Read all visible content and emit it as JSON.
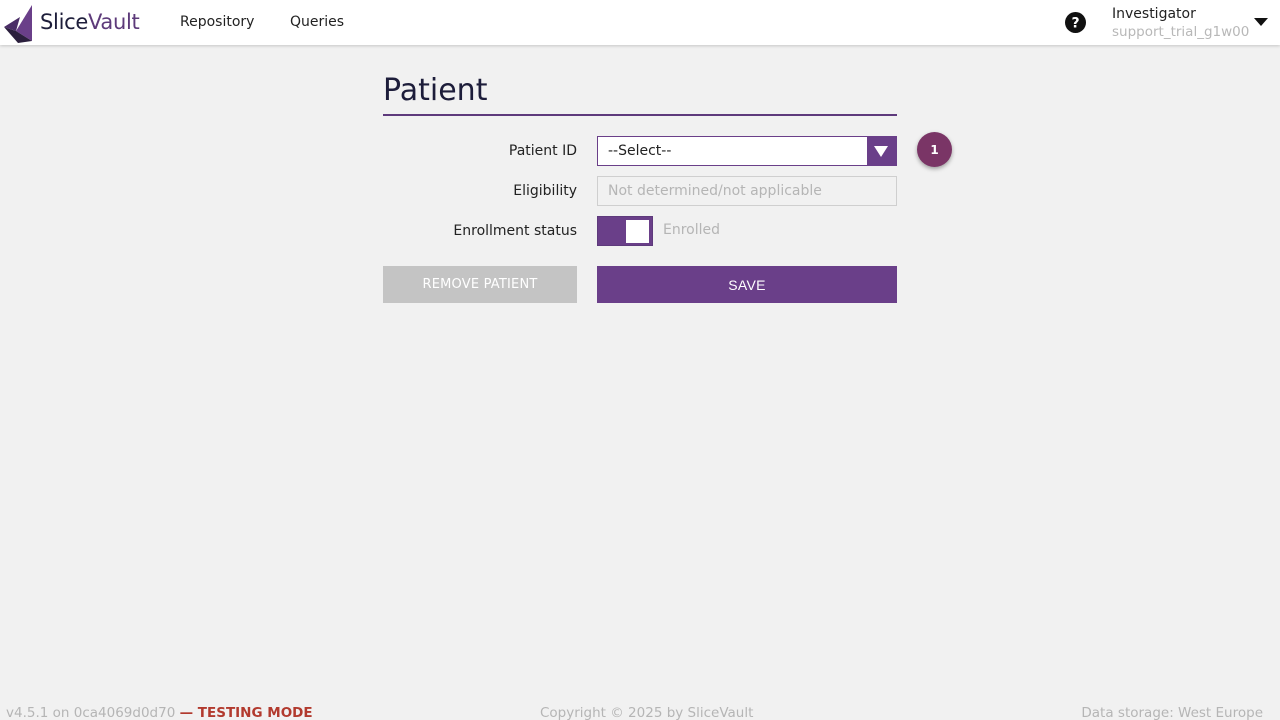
{
  "header": {
    "brand_part1": "Slice",
    "brand_part2": "Vault",
    "nav": [
      {
        "label": "Repository"
      },
      {
        "label": "Queries"
      }
    ],
    "help_icon": "question-circle-icon",
    "user": {
      "role": "Investigator",
      "username": "support_trial_g1w00"
    }
  },
  "main": {
    "title": "Patient",
    "fields": {
      "patient_id": {
        "label": "Patient ID",
        "value": "--Select--"
      },
      "eligibility": {
        "label": "Eligibility",
        "placeholder": "Not determined/not applicable"
      },
      "enrollment": {
        "label": "Enrollment status",
        "state_label": "Enrolled",
        "on": true
      }
    },
    "step_badge": "1",
    "buttons": {
      "remove": "REMOVE PATIENT",
      "save": "SAVE"
    }
  },
  "footer": {
    "version": "v4.5.1 on 0ca4069d0d70",
    "mode": "— TESTING MODE",
    "copyright": "Copyright © 2025 by SliceVault",
    "storage": "Data storage: West Europe"
  },
  "colors": {
    "accent": "#6a3f89",
    "badge": "#7a3566",
    "warning": "#b23a2e",
    "background": "#f1f1f1"
  }
}
